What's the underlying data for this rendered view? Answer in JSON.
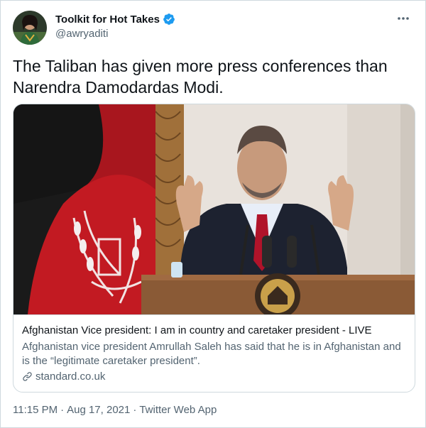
{
  "author": {
    "display_name": "Toolkit for Hot Takes",
    "handle": "@awryaditi"
  },
  "tweet": {
    "text_line1": "The Taliban has given more press conferences than",
    "text_line2": "Narendra Damodardas Modi."
  },
  "card": {
    "title": "Afghanistan Vice president: I am in country and caretaker president - LIVE",
    "description": "Afghanistan vice president Amrullah Saleh has said that he is in Afghanistan and is the “legitimate caretaker president”.",
    "domain": "standard.co.uk"
  },
  "meta": {
    "time": "11:15 PM",
    "separator1": "·",
    "date": "Aug 17, 2021",
    "separator2": "·",
    "source": "Twitter Web App"
  },
  "icons": {
    "verified": "verified-badge-icon",
    "more": "more-dots-icon",
    "link": "link-icon"
  },
  "colors": {
    "verified": "#1d9bf0",
    "text": "#0f1419",
    "secondary": "#536471",
    "border": "#cfd9de"
  }
}
